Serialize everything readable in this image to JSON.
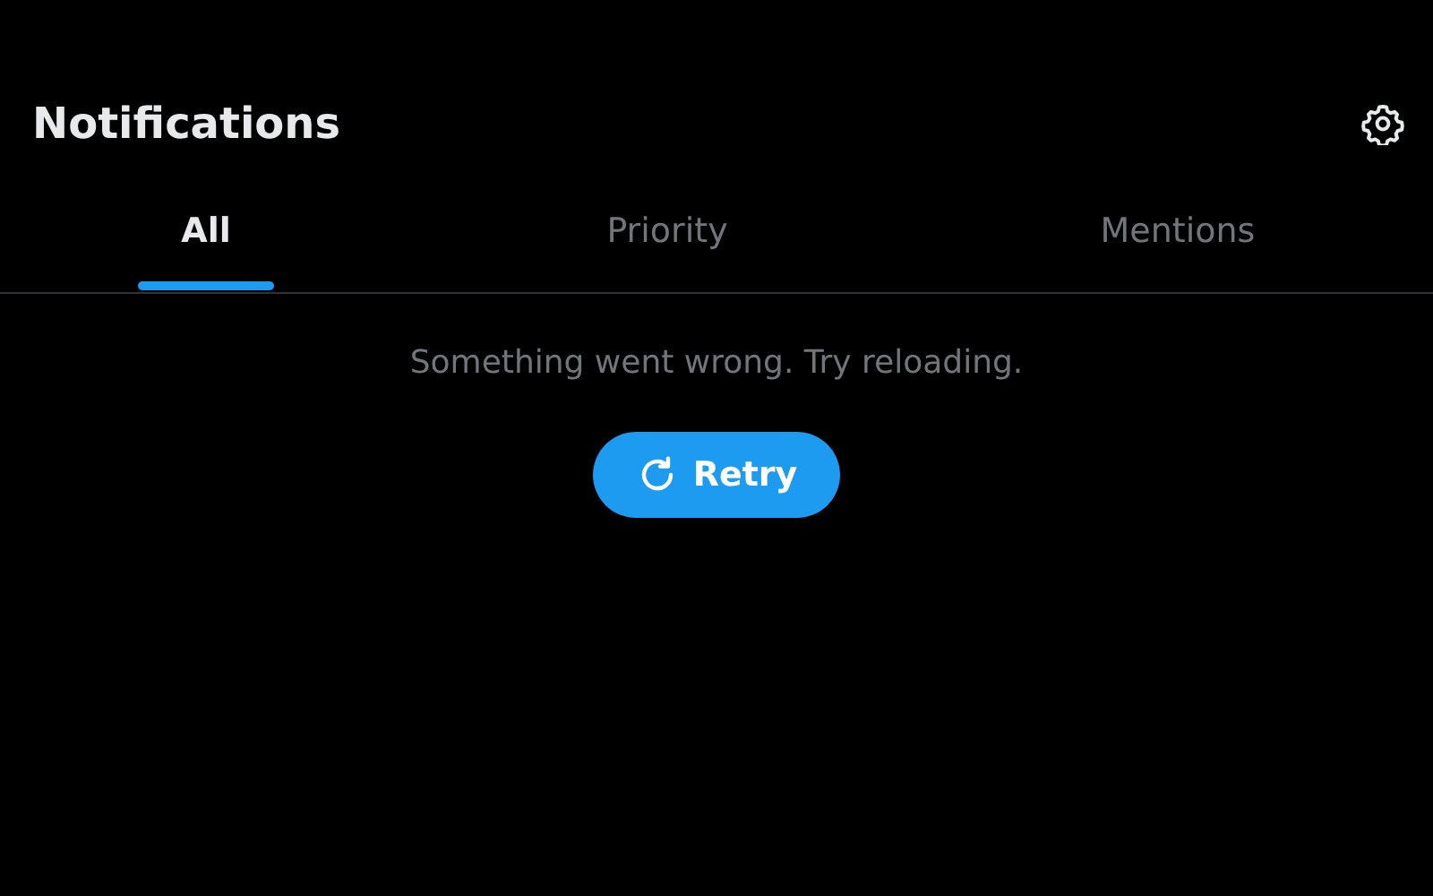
{
  "header": {
    "title": "Notifications"
  },
  "tabs": [
    {
      "label": "All",
      "selected": true
    },
    {
      "label": "Priority",
      "selected": false
    },
    {
      "label": "Mentions",
      "selected": false
    }
  ],
  "error": {
    "message": "Something went wrong. Try reloading.",
    "button": "Retry"
  }
}
